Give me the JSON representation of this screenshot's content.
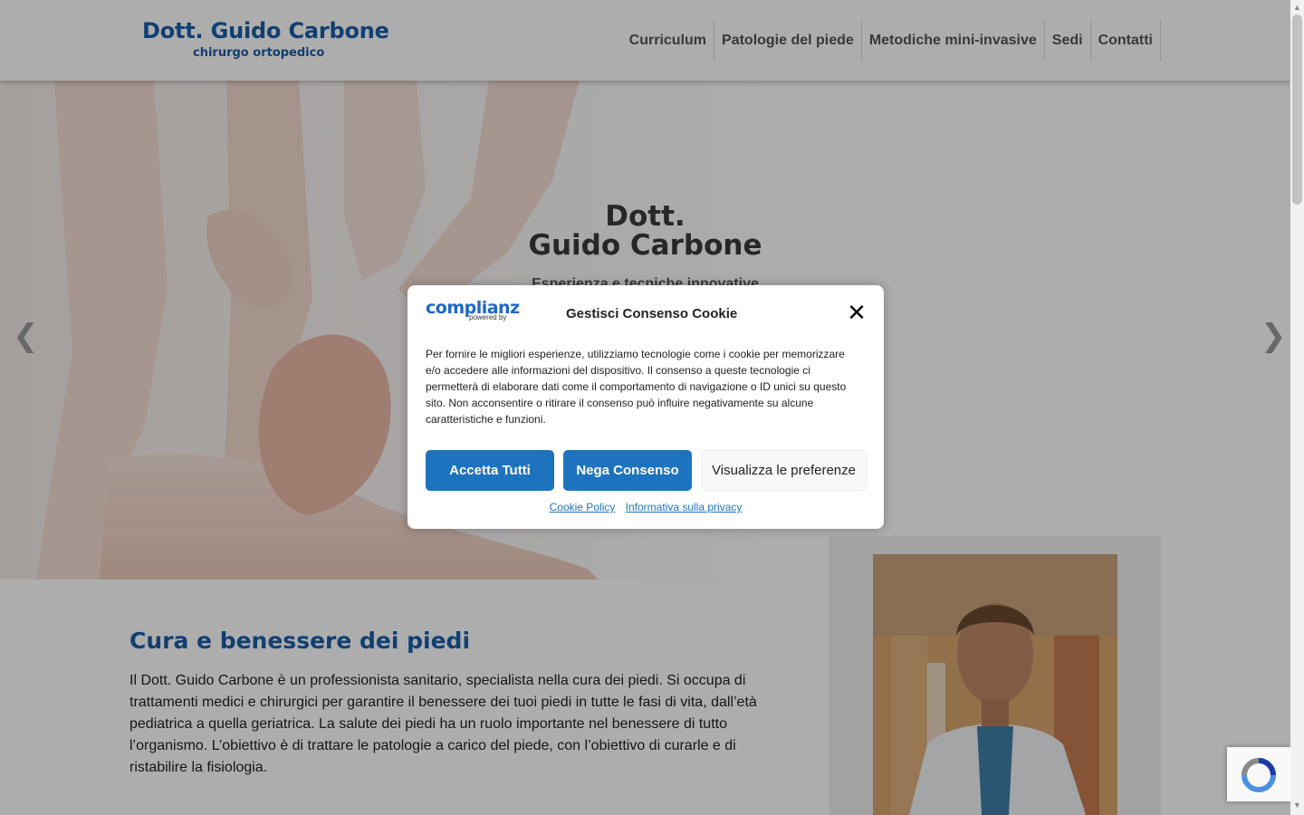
{
  "header": {
    "logo_name": "Dott. Guido Carbone",
    "logo_sub": "chirurgo ortopedico",
    "nav": [
      "Curriculum",
      "Patologie del piede",
      "Metodiche mini-invasive",
      "Sedi",
      "Contatti"
    ]
  },
  "hero": {
    "title_line1": "Dott.",
    "title_line2": "Guido Carbone",
    "subtitle": "Esperienza e tecniche innovative",
    "prev_icon": "chevron-left-icon",
    "next_icon": "chevron-right-icon"
  },
  "content": {
    "title": "Cura e benessere dei piedi",
    "text": "Il Dott. Guido Carbone è un professionista sanitario, specialista nella cura dei piedi. Si occupa di trattamenti medici e chirurgici per garantire il benessere dei tuoi piedi in tutte le fasi di vita, dall’età pediatrica a quella geriatrica. La salute dei piedi ha un ruolo importante nel benessere di tutto l’organismo. L’obiettivo è di trattare le patologie a carico del piede, con l’obiettivo di curarle e di ristabilire la fisiologia."
  },
  "cookie_modal": {
    "brand": "complianz",
    "brand_by": "powered by",
    "title": "Gestisci Consenso Cookie",
    "close_icon": "close-icon",
    "text": "Per fornire le migliori esperienze, utilizziamo tecnologie come i cookie per memorizzare e/o accedere alle informazioni del dispositivo. Il consenso a queste tecnologie ci permetterà di elaborare dati come il comportamento di navigazione o ID unici su questo sito. Non acconsentire o ritirare il consenso può influire negativamente su alcune caratteristiche e funzioni.",
    "accept": "Accetta Tutti",
    "deny": "Nega Consenso",
    "preferences": "Visualizza le preferenze",
    "cookie_policy": "Cookie Policy",
    "privacy": "Informativa sulla privacy"
  },
  "colors": {
    "brand_blue": "#1a5ea9",
    "button_blue": "#1e73be"
  }
}
